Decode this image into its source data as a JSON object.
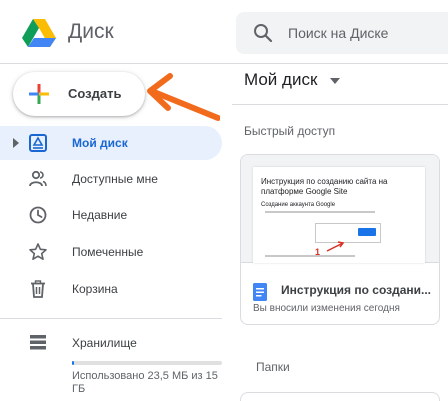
{
  "header": {
    "app_title": "Диск",
    "search_placeholder": "Поиск на Диске"
  },
  "create": {
    "label": "Создать"
  },
  "sidebar": {
    "items": [
      {
        "label": "Мой диск",
        "icon": "my-drive-icon",
        "active": true
      },
      {
        "label": "Доступные мне",
        "icon": "shared-with-me-icon"
      },
      {
        "label": "Недавние",
        "icon": "clock-icon"
      },
      {
        "label": "Помеченные",
        "icon": "star-icon"
      },
      {
        "label": "Корзина",
        "icon": "trash-icon"
      }
    ],
    "storage": {
      "label": "Хранилище",
      "icon": "storage-icon",
      "used_text": "Использовано 23,5 МБ из 15 ГБ",
      "used_fraction": 0.0015
    }
  },
  "main": {
    "title": "Мой диск",
    "quick_access_heading": "Быстрый доступ",
    "folders_heading": "Папки",
    "card": {
      "thumb_title": "Инструкция по созданию сайта на платформе Google Site",
      "thumb_subtitle": "Создание аккаунта Google",
      "thumb_number": "1",
      "name": "Инструкция по создани...",
      "meta": "Вы вносили изменения сегодня"
    }
  },
  "colors": {
    "accent": "#1a73e8",
    "active_bg": "#e8f0fe",
    "arrow": "#f26b1d",
    "doc_icon": "#4285f4"
  }
}
